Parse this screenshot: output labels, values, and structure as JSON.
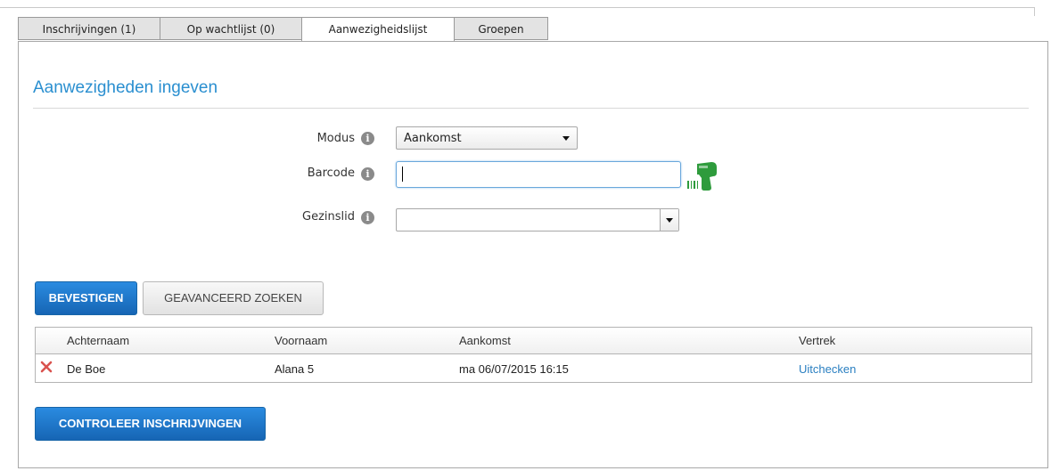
{
  "tabs": [
    {
      "label": "Inschrijvingen (1)",
      "active": false
    },
    {
      "label": "Op wachtlijst (0)",
      "active": false
    },
    {
      "label": "Aanwezigheidslijst",
      "active": true
    },
    {
      "label": "Groepen",
      "active": false
    }
  ],
  "section": {
    "title": "Aanwezigheden ingeven"
  },
  "form": {
    "modus": {
      "label": "Modus",
      "value": "Aankomst",
      "icon": "info-icon"
    },
    "barcode": {
      "label": "Barcode",
      "value": "",
      "icon": "info-icon",
      "scanner_icon": "barcode-scanner-icon"
    },
    "gezinslid": {
      "label": "Gezinslid",
      "value": "",
      "icon": "info-icon"
    }
  },
  "actions": {
    "confirm_label": "BEVESTIGEN",
    "advanced_label": "GEAVANCEERD ZOEKEN",
    "check_label": "CONTROLEER INSCHRIJVINGEN"
  },
  "table": {
    "columns": [
      "Achternaam",
      "Voornaam",
      "Aankomst",
      "Vertrek"
    ],
    "rows": [
      {
        "achternaam": "De Boe",
        "voornaam": "Alana 5",
        "aankomst": "ma 06/07/2015 16:15",
        "vertrek": "Uitchecken"
      }
    ]
  },
  "colors": {
    "accent": "#2a8fd0",
    "primary_button": "#1a73c4",
    "scanner": "#2e9b3c",
    "delete": "#d9534f"
  }
}
